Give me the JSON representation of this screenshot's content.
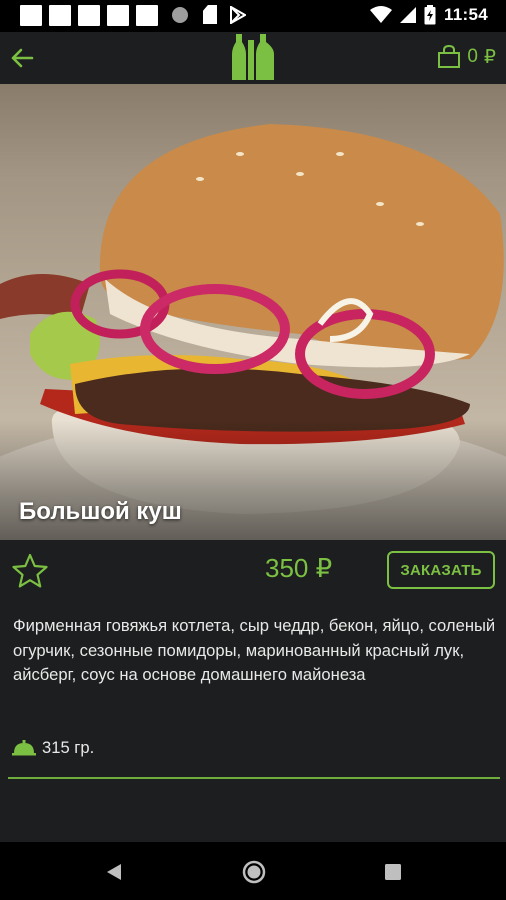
{
  "status_bar": {
    "time": "11:54",
    "icons": [
      "notification-square-icon",
      "notification-square-icon",
      "notification-square-icon",
      "notification-square-icon",
      "notification-square-icon",
      "circle-icon",
      "sd-card-icon",
      "play-store-icon",
      "wifi-icon",
      "signal-icon",
      "battery-icon"
    ]
  },
  "app_bar": {
    "back_icon": "arrow-left-icon",
    "logo_icon": "bottles-logo-icon",
    "cart_icon": "shopping-bag-icon",
    "cart_count": "0",
    "currency": "₽"
  },
  "product": {
    "title": "Большой куш",
    "image": "burger-photo",
    "price": "350 ₽",
    "order_label": "ЗАКАЗАТЬ",
    "favorite_icon": "star-outline-icon",
    "description": "Фирменная говяжья котлета, сыр чеддр, бекон, яйцо, соленый огурчик, сезонные помидоры, маринованный красный лук, айсберг, соус на основе домашнего майонеза",
    "weight_icon": "cloche-icon",
    "weight": "315 гр."
  },
  "nav_bar": {
    "back_icon": "triangle-back-icon",
    "home_icon": "circle-home-icon",
    "recent_icon": "square-recent-icon"
  },
  "colors": {
    "accent": "#7cc043",
    "background": "#1c1e1f",
    "bars": "#000000"
  }
}
